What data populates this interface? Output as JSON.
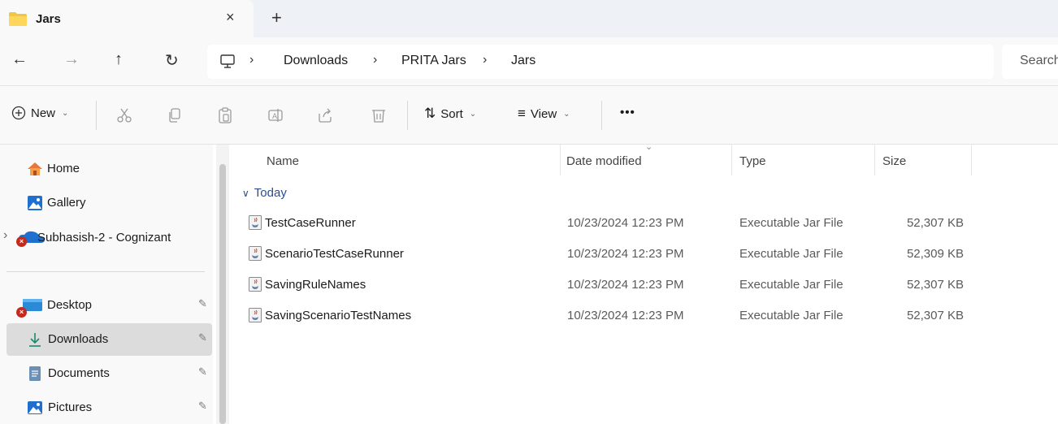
{
  "tab": {
    "title": "Jars",
    "close": "×",
    "new_tab": "+"
  },
  "nav": {
    "back": "←",
    "forward": "→",
    "up": "↑",
    "refresh": "↻",
    "breadcrumbs": [
      "Downloads",
      "PRITA Jars",
      "Jars"
    ],
    "separator": "›",
    "search_placeholder": "Search"
  },
  "toolbar": {
    "new_label": "New",
    "sort_label": "Sort",
    "view_label": "View",
    "more_label": "•••",
    "chevron": "⌄"
  },
  "sidebar": {
    "items": [
      {
        "label": "Home",
        "icon": "home-icon"
      },
      {
        "label": "Gallery",
        "icon": "gallery-icon"
      },
      {
        "label": "Subhasish-2 - Cognizant",
        "icon": "onedrive-icon"
      },
      {
        "label": "Desktop",
        "icon": "desktop-icon"
      },
      {
        "label": "Downloads",
        "icon": "download-icon"
      },
      {
        "label": "Documents",
        "icon": "documents-icon"
      },
      {
        "label": "Pictures",
        "icon": "pictures-icon"
      }
    ],
    "pin_glyph": "📌",
    "expand_glyph": "›",
    "error_glyph": "×"
  },
  "columns": {
    "name": "Name",
    "date": "Date modified",
    "type": "Type",
    "size": "Size"
  },
  "group": {
    "label": "Today",
    "chevron": "∨"
  },
  "files": [
    {
      "name": "TestCaseRunner",
      "date": "10/23/2024 12:23 PM",
      "type": "Executable Jar File",
      "size": "52,307 KB"
    },
    {
      "name": "ScenarioTestCaseRunner",
      "date": "10/23/2024 12:23 PM",
      "type": "Executable Jar File",
      "size": "52,309 KB"
    },
    {
      "name": "SavingRuleNames",
      "date": "10/23/2024 12:23 PM",
      "type": "Executable Jar File",
      "size": "52,307 KB"
    },
    {
      "name": "SavingScenarioTestNames",
      "date": "10/23/2024 12:23 PM",
      "type": "Executable Jar File",
      "size": "52,307 KB"
    }
  ],
  "colors": {
    "accent": "#0067c0",
    "folder": "#f4c542",
    "group_text": "#2a4e8c",
    "selected_bg": "#dcdcdc"
  }
}
